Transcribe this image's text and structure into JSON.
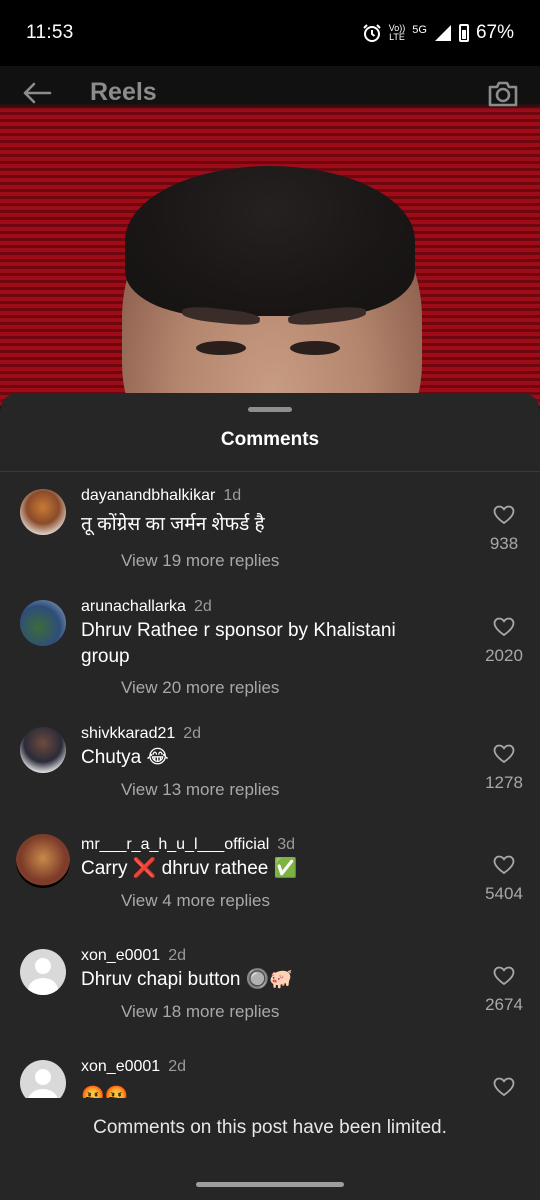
{
  "status_bar": {
    "time": "11:53",
    "network_top": "Vo))",
    "network_bottom": "LTE",
    "network_gen": "5G",
    "battery": "67%"
  },
  "topbar": {
    "title": "Reels",
    "icons": [
      "back-arrow-icon",
      "camera-icon"
    ]
  },
  "sheet": {
    "title": "Comments",
    "limited_notice": "Comments on this post have been limited."
  },
  "comments": [
    {
      "username": "dayanandbhalkikar",
      "time": "1d",
      "text": "तू कोंग्रेस का जर्मन शेफर्ड है",
      "replies": "View 19 more replies",
      "likes": "938"
    },
    {
      "username": "arunachallarka",
      "time": "2d",
      "text": "Dhruv Rathee r sponsor by Khalistani group",
      "replies": "View 20 more replies",
      "likes": "2020"
    },
    {
      "username": "shivkkarad21",
      "time": "2d",
      "text": "Chutya 😂",
      "replies": "View 13 more replies",
      "likes": "1278"
    },
    {
      "username": "mr___r_a_h_u_l___official",
      "time": "3d",
      "text": "Carry ❌ dhruv rathee ✅",
      "replies": "View 4 more replies",
      "likes": "5404"
    },
    {
      "username": "xon_e0001",
      "time": "2d",
      "text": "Dhruv chapi button 🔘🐖",
      "replies": "View 18 more replies",
      "likes": "2674"
    },
    {
      "username": "xon_e0001",
      "time": "2d",
      "text": "🤬🤬",
      "replies": "",
      "likes": ""
    }
  ],
  "colors": {
    "sheet_bg": "#262626",
    "secondary_text": "#a8a8a8",
    "video_red": "#9e0c18"
  }
}
